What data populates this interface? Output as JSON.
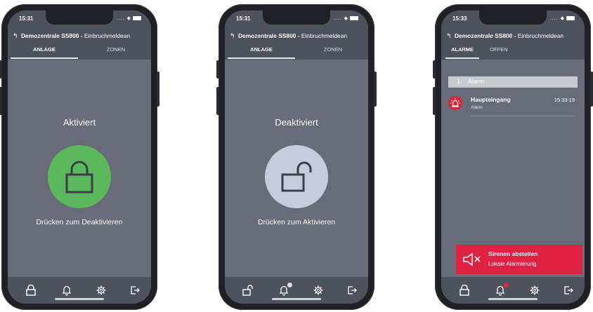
{
  "phones": [
    {
      "time": "15:31",
      "title_bold": "Demozentrale SS800 -",
      "title_rest": "Einbruchmeldean",
      "tabs": [
        "ANLAGE",
        "ZONEN"
      ],
      "state_label": "Aktiviert",
      "hint": "Drücken zum Deaktivieren",
      "lock_color": "#5cb85c"
    },
    {
      "time": "15:31",
      "title_bold": "Demozentrale SS800 -",
      "title_rest": "Einbruchmeldean",
      "tabs": [
        "ANLAGE",
        "ZONEN"
      ],
      "state_label": "Deaktiviert",
      "hint": "Drücken zum Aktivieren",
      "lock_color": "#c8cbdc"
    },
    {
      "time": "15:33",
      "title_bold": "Demozentrale SS800 -",
      "title_rest": "Einbruchmeldean",
      "tabs": [
        "ALARME",
        "OFFEN"
      ],
      "group_count": "1",
      "group_label": "Alarm",
      "alarm": {
        "name": "Haupteingang",
        "sub": "Alarm",
        "time": "15:33:19"
      },
      "siren": {
        "title": "Sirenen abstellen",
        "sub": "Lokale Alarmierung"
      },
      "accent_color": "#e02142"
    }
  ],
  "icons": {
    "nav": [
      "lock-icon",
      "bell-icon",
      "gear-icon",
      "logout-icon"
    ],
    "siren": "speaker-mute-icon",
    "alarm": "alarm-light-icon"
  }
}
